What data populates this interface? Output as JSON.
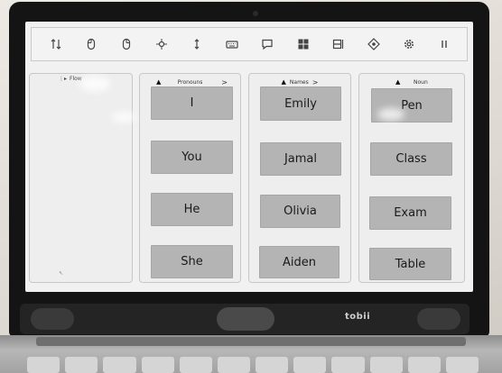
{
  "toolbar": {
    "icons": [
      "sort-icon",
      "left-click-icon",
      "right-click-icon",
      "drag-icon",
      "scroll-icon",
      "keyboard-icon",
      "chat-icon",
      "windows-start-icon",
      "task-switcher-icon",
      "gaze-icon",
      "settings-icon",
      "pause-icon"
    ]
  },
  "flow_panel": {
    "title": "Flow"
  },
  "pronouns": {
    "title": "Pronouns",
    "words": [
      "I",
      "You",
      "He",
      "She"
    ]
  },
  "names": {
    "title": "Names",
    "words": [
      "Emily",
      "Jamal",
      "Olivia",
      "Aiden"
    ]
  },
  "noun": {
    "title": "Noun",
    "words": [
      "Pen",
      "Class",
      "Exam",
      "Table"
    ]
  },
  "hardware": {
    "tracker_logo": "tobii"
  }
}
